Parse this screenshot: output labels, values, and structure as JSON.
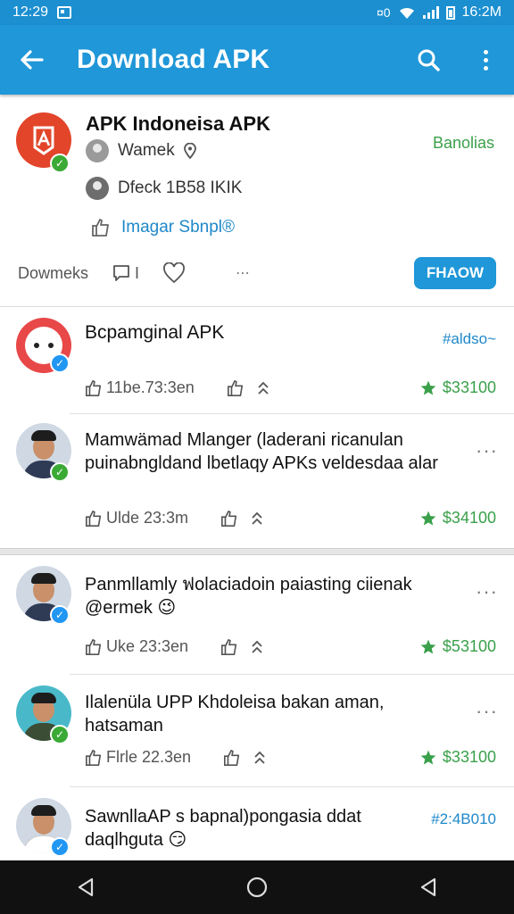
{
  "status_bar": {
    "time_left": "12:29",
    "time_right": "16:2M",
    "bt_label": "¤0"
  },
  "app_bar": {
    "title": "Download APK",
    "back_icon": "arrow-left-icon",
    "search_icon": "search-icon",
    "overflow_icon": "more-vertical-icon"
  },
  "header_card": {
    "title": "APK Indoneisa APK",
    "author": "Wamek",
    "meta": "Dfeck 1B58 IKIK",
    "link": "Imagar Sbnpl®",
    "badge": "Banolias",
    "downloads_label": "Dowmeks",
    "comment_count": "I",
    "follow_label": "FHAOW",
    "accent": "#1f97d8"
  },
  "posts": [
    {
      "text": "Bcpamginal APK",
      "tag": "#aldso~",
      "likes": "11be.73:3en",
      "price": "$33100",
      "avatar": "app-icon"
    },
    {
      "text": "Mamwämad Mlanger (laderani ricanulan puinabngldand lbetlaqy APKs veldesdaa alar",
      "likes": "Ulde 23:3m",
      "price": "$34100",
      "avatar": "person"
    },
    {
      "text": "Panmllamly ฟolaciadoin paiasting ciienak @ermek 😉",
      "likes": "Uke 23:3en",
      "price": "$53100",
      "avatar": "person"
    },
    {
      "text": "Ilalenüla UPP Khdoleisa bakan aman, hatsaman",
      "likes": "Flrle 22.3en",
      "price": "$33100",
      "avatar": "person"
    },
    {
      "text": "SawnllaAP s bapnal)pongasia ddat daqlhguta 😏",
      "tag": "#2:4B010",
      "avatar": "person"
    }
  ],
  "nav_bar": {
    "back": "nav-back-icon",
    "home": "nav-home-icon",
    "recent": "nav-recents-icon"
  }
}
